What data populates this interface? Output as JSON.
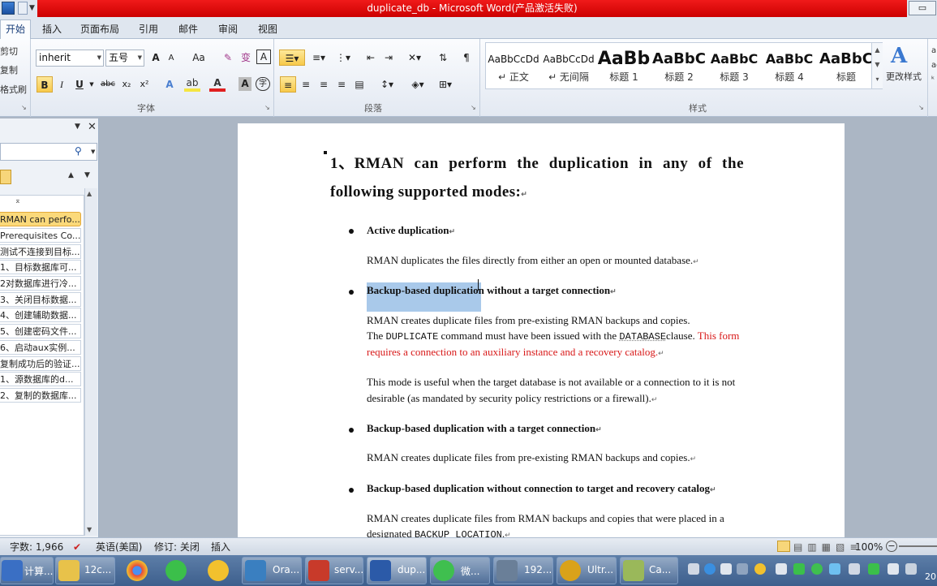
{
  "window": {
    "title": "duplicate_db - Microsoft Word(产品激活失败)",
    "controls": "▭"
  },
  "tabs": [
    "开始",
    "插入",
    "页面布局",
    "引用",
    "邮件",
    "审阅",
    "视图"
  ],
  "clipboard": {
    "cut": "剪切",
    "copy": "复制",
    "format_painter": "格式刷"
  },
  "font": {
    "name": "inherit",
    "size": "五号",
    "group_label": "字体",
    "grow": "A",
    "shrink": "A",
    "case": "Aa",
    "clear": "A",
    "bold": "B",
    "italic": "I",
    "underline": "U",
    "strike": "abc",
    "subscript": "x₂",
    "superscript": "x²",
    "char_border": "A"
  },
  "paragraph": {
    "group_label": "段落"
  },
  "styles": {
    "group_label": "样式",
    "items": [
      {
        "sample": "AaBbCcDd",
        "name": "↵ 正文"
      },
      {
        "sample": "AaBbCcDd",
        "name": "↵ 无间隔"
      },
      {
        "sample": "AaBb",
        "name": "标题 1"
      },
      {
        "sample": "AaBbC",
        "name": "标题 2"
      },
      {
        "sample": "AaBbC",
        "name": "标题 3"
      },
      {
        "sample": "AaBbC",
        "name": "标题 4"
      },
      {
        "sample": "AaBbC",
        "name": "标题"
      }
    ],
    "change_styles": "更改样式"
  },
  "nav": {
    "items": [
      "RMAN can perfo...",
      "Prerequisites Co...",
      "测试不连接到目标...",
      "1、目标数据库可...",
      "2对数据库进行冷...",
      "3、关闭目标数据...",
      "4、创建辅助数据...",
      "5、创建密码文件...",
      "6、启动aux实例...",
      "复制成功后的验证...",
      "1、源数据库的d...",
      "2、复制的数据库..."
    ]
  },
  "document": {
    "heading_line1": "1、RMAN can perform the duplication in any of the",
    "heading_line2": "following supported modes:",
    "mode1_title": "Active duplication",
    "mode1_text": "RMAN duplicates the files directly from either an open or mounted database.",
    "mode2_title_sel": "Backup-based duplicatio",
    "mode2_title_rest": "n without a target connection",
    "mode2_line1": "RMAN creates duplicate files from pre-existing RMAN backups and copies.",
    "mode2_line2a": "The ",
    "mode2_line2_code1": "DUPLICATE",
    "mode2_line2b": " command must have been issued with the ",
    "mode2_line2_code2": "DATABASE",
    "mode2_line2c": "clause. ",
    "mode2_line2_red": "This form",
    "mode2_line3_red": "requires a connection to an auxiliary instance and a recovery catalog.",
    "mode2_para2_line1": "This mode is useful when the target database is not available or a connection to it is not",
    "mode2_para2_line2": "desirable (as mandated by security policy restrictions or a firewall).",
    "mode3_title": "Backup-based duplication with a target connection",
    "mode3_text": "RMAN creates duplicate files from pre-existing RMAN backups and copies.",
    "mode4_title": "Backup-based duplication without connection to target and recovery catalog",
    "mode4_line1": "RMAN creates duplicate files from RMAN backups and copies that were placed in a",
    "mode4_line2a": "designated ",
    "mode4_line2_code": "BACKUP LOCATION",
    "mode4_line2b": ".",
    "para_mark": "↵"
  },
  "status": {
    "words": "字数: 1,966",
    "language": "英语(美国)",
    "revisions": "修订: 关闭",
    "insert": "插入",
    "zoom": "100%"
  },
  "taskbar": {
    "items": [
      {
        "label": "计算...",
        "icon": "computer-icon",
        "color": "#3a6fc4"
      },
      {
        "label": "12c...",
        "icon": "folder-icon",
        "color": "#e8c24a"
      },
      {
        "label": "",
        "icon": "chrome-icon",
        "color": "#e84a3a"
      },
      {
        "label": "",
        "icon": "media-player-icon",
        "color": "#3bbf4a"
      },
      {
        "label": "",
        "icon": "qq-icon",
        "color": "#f2c12e"
      },
      {
        "label": "Ora...",
        "icon": "virtualbox-icon",
        "color": "#3a7fc0"
      },
      {
        "label": "serv...",
        "icon": "terminal-icon",
        "color": "#c83a2a"
      },
      {
        "label": "dup...",
        "icon": "word-icon",
        "color": "#2b5aa8"
      },
      {
        "label": "微...",
        "icon": "wechat-icon",
        "color": "#3fbf4f"
      },
      {
        "label": "192...",
        "icon": "remote-desktop-icon",
        "color": "#6a7f98"
      },
      {
        "label": "Ultr...",
        "icon": "ultraedit-icon",
        "color": "#d9a21a"
      },
      {
        "label": "Ca...",
        "icon": "notes-icon",
        "color": "#9ab85a"
      }
    ],
    "clock": "20"
  }
}
